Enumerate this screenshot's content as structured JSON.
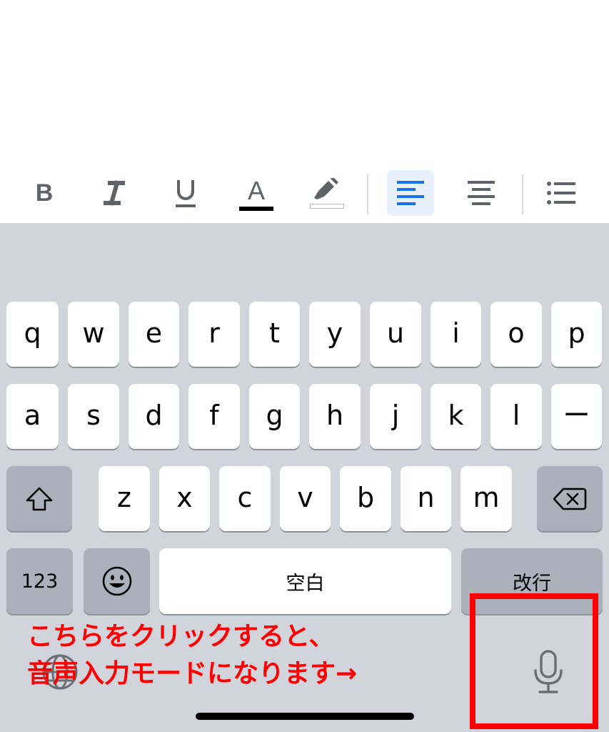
{
  "toolbar": {
    "bold": "B",
    "font_color": "A",
    "colors": {
      "accent": "#1a73e8",
      "active_bg": "#e8f0fe",
      "icon": "#5f6368"
    }
  },
  "keyboard": {
    "row1": [
      "q",
      "w",
      "e",
      "r",
      "t",
      "y",
      "u",
      "i",
      "o",
      "p"
    ],
    "row2": [
      "a",
      "s",
      "d",
      "f",
      "g",
      "h",
      "j",
      "k",
      "l",
      "ー"
    ],
    "row3": [
      "z",
      "x",
      "c",
      "v",
      "b",
      "n",
      "m"
    ],
    "numbers_key": "123",
    "space_key": "空白",
    "return_key": "改行"
  },
  "annotation": {
    "line1": "こちらをクリックすると、",
    "line2": "音声入力モードになります→",
    "color": "#ff0000"
  }
}
